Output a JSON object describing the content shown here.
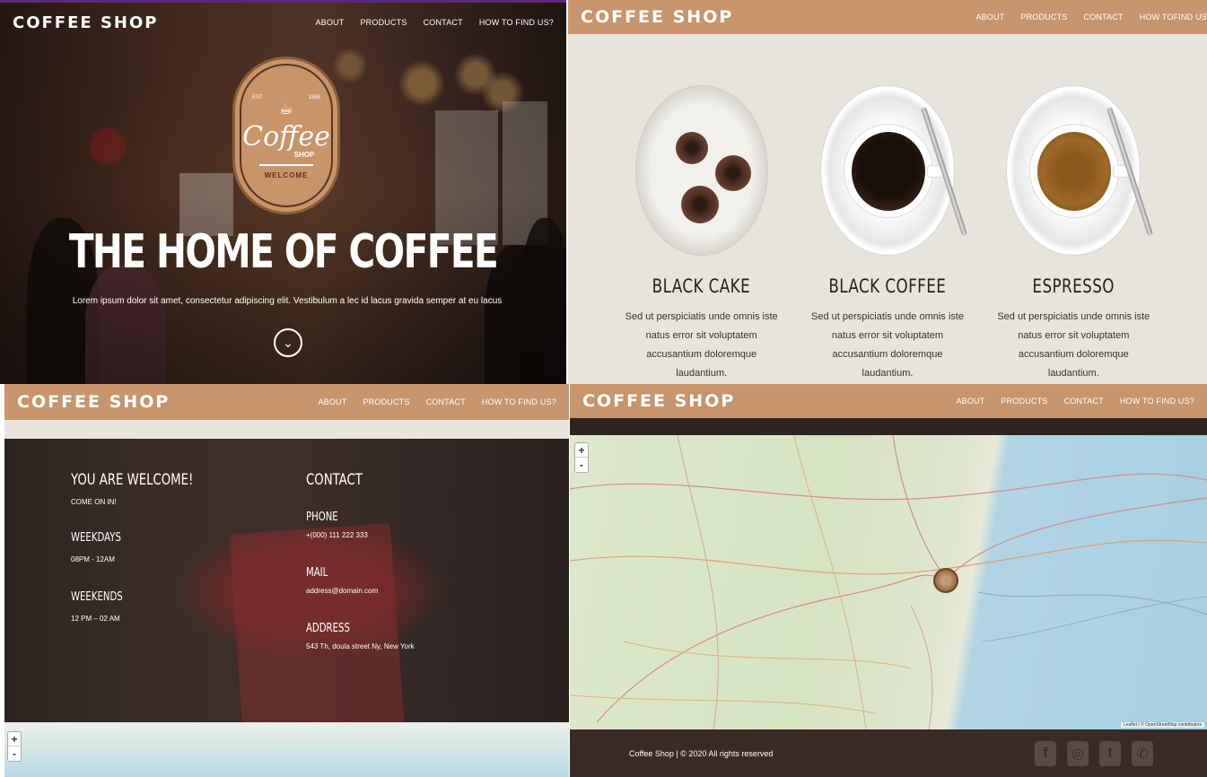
{
  "brand": "COFFEE SHOP",
  "nav": {
    "about": "ABOUT",
    "products": "PRODUCTS",
    "contact": "CONTACT",
    "find": "HOW TO FIND US?",
    "find_alt": "HOW TOFIND US"
  },
  "hero": {
    "title": "THE HOME OF COFFEE",
    "subtitle": "Lorem ipsum dolor sit amet, consectetur adipiscing elit. Vestibulum a lec id lacus gravida semper at eu lacus",
    "logo": {
      "est": "EST.",
      "year": "1985",
      "main": "Coffee",
      "shop": "SHOP",
      "welcome": "WELCOME"
    }
  },
  "products": [
    {
      "name": "BLACK CAKE",
      "desc": "Sed ut perspiciatis unde omnis iste natus error sit voluptatem accusantium doloremque laudantium."
    },
    {
      "name": "BLACK COFFEE",
      "desc": "Sed ut perspiciatis unde omnis iste natus error sit voluptatem accusantium doloremque laudantium."
    },
    {
      "name": "ESPRESSO",
      "desc": "Sed ut perspiciatis unde omnis iste natus error sit voluptatem accusantium doloremque laudantium."
    }
  ],
  "contact": {
    "welcome_title": "YOU ARE WELCOME!",
    "welcome_sub": "COME ON IN!",
    "weekdays_title": "WEEKDAYS",
    "weekdays_hours": "08PM - 12AM",
    "weekends_title": "WEEKENDS",
    "weekends_hours": "12 PM – 02 AM",
    "contact_title": "CONTACT",
    "phone_title": "PHONE",
    "phone_value": "+(000) 111 222 333",
    "mail_title": "MAIL",
    "mail_value": "address@domain.com",
    "address_title": "ADDRESS",
    "address_value": "543 Th, doula street Ny, New York"
  },
  "map": {
    "zoom_in": "+",
    "zoom_out": "-",
    "attribution": "Leaflet | © OpenStreetMap contributors"
  },
  "footer": {
    "copyright": "Coffee Shop | © 2020 All rights reserved",
    "social": [
      "facebook-icon",
      "instagram-icon",
      "twitter-icon",
      "whatsapp-icon"
    ]
  },
  "colors": {
    "nav_bg": "#c7956d",
    "cream": "#e8e4dc",
    "footer_bg": "#3b2a26"
  }
}
